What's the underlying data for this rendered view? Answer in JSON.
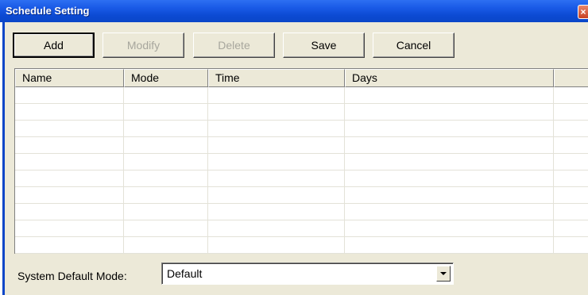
{
  "window": {
    "title": "Schedule Setting",
    "close_glyph": "×",
    "close_icon": "close-icon"
  },
  "toolbar": {
    "buttons": [
      {
        "label": "Add",
        "enabled": true
      },
      {
        "label": "Modify",
        "enabled": false
      },
      {
        "label": "Delete",
        "enabled": false
      },
      {
        "label": "Save",
        "enabled": true
      },
      {
        "label": "Cancel",
        "enabled": true
      }
    ]
  },
  "table": {
    "columns": [
      "Name",
      "Mode",
      "Time",
      "Days",
      ""
    ],
    "rows": [
      [
        "",
        "",
        "",
        "",
        ""
      ],
      [
        "",
        "",
        "",
        "",
        ""
      ],
      [
        "",
        "",
        "",
        "",
        ""
      ],
      [
        "",
        "",
        "",
        "",
        ""
      ],
      [
        "",
        "",
        "",
        "",
        ""
      ],
      [
        "",
        "",
        "",
        "",
        ""
      ],
      [
        "",
        "",
        "",
        "",
        ""
      ],
      [
        "",
        "",
        "",
        "",
        ""
      ],
      [
        "",
        "",
        "",
        "",
        ""
      ],
      [
        "",
        "",
        "",
        "",
        ""
      ]
    ]
  },
  "footer": {
    "default_mode_label": "System Default Mode:",
    "default_mode_value": "Default",
    "dropdown_icon": "chevron-down-icon"
  },
  "colors": {
    "titlebar": "#0a46c8",
    "face": "#ece9d8",
    "disabled_text": "#a7a69d",
    "close_button": "#c84224"
  }
}
